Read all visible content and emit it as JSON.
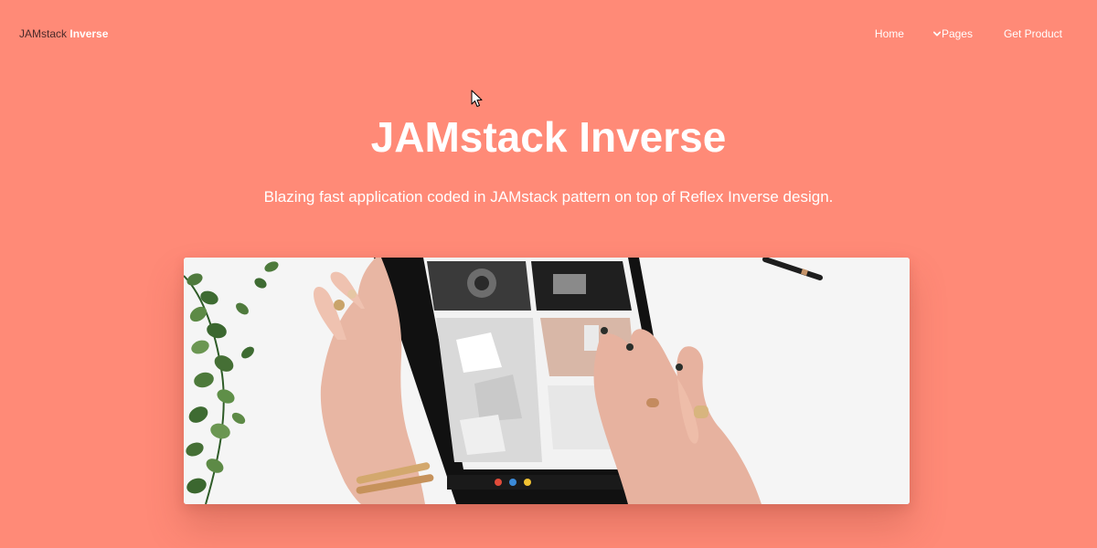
{
  "navbar": {
    "brand": {
      "part1": "JAMstack",
      "part2": "Inverse"
    },
    "links": {
      "home": "Home",
      "pages": "Pages",
      "get_product": "Get Product"
    },
    "icons": {
      "pages_chevron": "chevron-down-icon"
    }
  },
  "hero": {
    "title": "JAMstack Inverse",
    "subtitle": "Blazing fast application coded in JAMstack pattern on top of Reflex Inverse design."
  },
  "colors": {
    "background": "#ff8a77",
    "text_light": "#ffffff",
    "brand_dark": "#4a2a2a"
  }
}
